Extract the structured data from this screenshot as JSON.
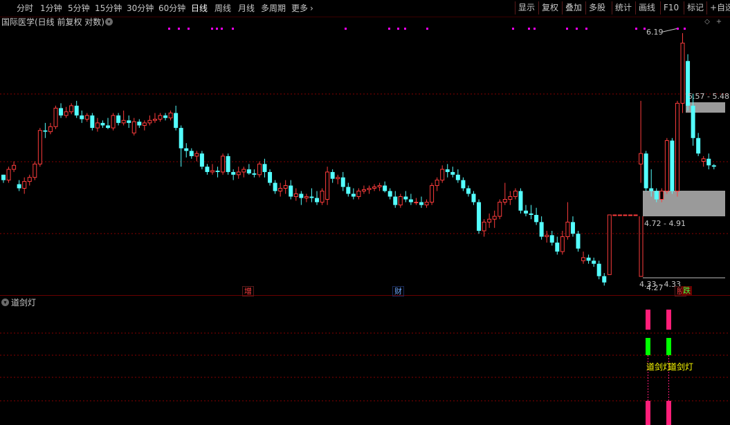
{
  "toolbar": {
    "periods": [
      "分时",
      "1分钟",
      "5分钟",
      "15分钟",
      "30分钟",
      "60分钟",
      "日线",
      "周线",
      "月线",
      "多周期",
      "更多"
    ],
    "active_period": "日线",
    "right_buttons": [
      "显示",
      "复权",
      "叠加",
      "多股",
      "统计",
      "画线",
      "F10",
      "标记",
      "+自选"
    ]
  },
  "chart": {
    "title": "国际医学(日线 前复权 对数)",
    "high_label": "6.19",
    "low_label": "4.27",
    "band_upper_label": "5.57 - 5.48",
    "band_lower_label": "4.72 - 4.91",
    "bottom_range_label": "4.33 - 4.33",
    "events": [
      {
        "text": "增",
        "color": "#ff4040"
      },
      {
        "text": "财",
        "color": "#6fa8ff"
      },
      {
        "text": "股",
        "color": "#ff4040"
      },
      {
        "text": "跌",
        "color": "#40ff40"
      }
    ]
  },
  "indicator": {
    "name": "道剑灯",
    "signal_label_1": "道剑灯",
    "signal_label_2": "道剑灯"
  },
  "colors": {
    "up": "#ff3c3c",
    "down": "#54ffff",
    "grid": "#8a0000",
    "marker": "#ff00ff",
    "signal_magenta": "#ff1e78",
    "signal_green": "#00ff00",
    "band": "#9a9a9a"
  },
  "candles": [
    [
      5.02,
      5.02,
      4.96,
      4.98
    ],
    [
      4.98,
      5.08,
      4.96,
      5.06
    ],
    [
      5.06,
      5.12,
      5.04,
      5.09
    ],
    [
      4.95,
      4.98,
      4.9,
      4.92
    ],
    [
      4.92,
      5.0,
      4.88,
      4.97
    ],
    [
      4.97,
      5.02,
      4.94,
      5.0
    ],
    [
      5.0,
      5.12,
      4.98,
      5.1
    ],
    [
      5.1,
      5.38,
      5.08,
      5.36
    ],
    [
      5.36,
      5.42,
      5.3,
      5.35
    ],
    [
      5.35,
      5.42,
      5.33,
      5.39
    ],
    [
      5.39,
      5.56,
      5.37,
      5.54
    ],
    [
      5.54,
      5.58,
      5.46,
      5.48
    ],
    [
      5.48,
      5.55,
      5.46,
      5.51
    ],
    [
      5.51,
      5.58,
      5.49,
      5.56
    ],
    [
      5.56,
      5.6,
      5.46,
      5.48
    ],
    [
      5.48,
      5.52,
      5.42,
      5.45
    ],
    [
      5.45,
      5.5,
      5.43,
      5.48
    ],
    [
      5.48,
      5.5,
      5.36,
      5.38
    ],
    [
      5.38,
      5.46,
      5.35,
      5.42
    ],
    [
      5.42,
      5.44,
      5.38,
      5.4
    ],
    [
      5.4,
      5.46,
      5.37,
      5.38
    ],
    [
      5.38,
      5.5,
      5.36,
      5.48
    ],
    [
      5.48,
      5.5,
      5.4,
      5.42
    ],
    [
      5.42,
      5.52,
      5.4,
      5.44
    ],
    [
      5.44,
      5.48,
      5.38,
      5.42
    ],
    [
      5.34,
      5.46,
      5.32,
      5.43
    ],
    [
      5.43,
      5.45,
      5.38,
      5.4
    ],
    [
      5.4,
      5.44,
      5.36,
      5.42
    ],
    [
      5.42,
      5.48,
      5.4,
      5.44
    ],
    [
      5.44,
      5.5,
      5.42,
      5.45
    ],
    [
      5.45,
      5.5,
      5.43,
      5.48
    ],
    [
      5.48,
      5.5,
      5.44,
      5.46
    ],
    [
      5.46,
      5.52,
      5.44,
      5.5
    ],
    [
      5.5,
      5.56,
      5.36,
      5.38
    ],
    [
      5.38,
      5.4,
      5.08,
      5.22
    ],
    [
      5.22,
      5.26,
      5.15,
      5.2
    ],
    [
      5.2,
      5.22,
      5.14,
      5.16
    ],
    [
      5.16,
      5.2,
      5.12,
      5.18
    ],
    [
      5.18,
      5.2,
      5.06,
      5.08
    ],
    [
      5.08,
      5.1,
      5.02,
      5.04
    ],
    [
      5.04,
      5.1,
      5.02,
      5.05
    ],
    [
      5.05,
      5.08,
      5.0,
      5.04
    ],
    [
      5.04,
      5.18,
      5.02,
      5.16
    ],
    [
      5.16,
      5.18,
      5.02,
      5.04
    ],
    [
      5.04,
      5.06,
      4.98,
      5.02
    ],
    [
      5.02,
      5.08,
      4.99,
      5.04
    ],
    [
      5.04,
      5.08,
      5.0,
      5.06
    ],
    [
      5.06,
      5.1,
      5.02,
      5.03
    ],
    [
      5.03,
      5.06,
      5.0,
      5.02
    ],
    [
      5.02,
      5.12,
      5.0,
      5.1
    ],
    [
      5.1,
      5.14,
      5.0,
      5.04
    ],
    [
      5.04,
      5.06,
      4.94,
      4.96
    ],
    [
      4.96,
      4.98,
      4.88,
      4.9
    ],
    [
      4.9,
      4.96,
      4.86,
      4.92
    ],
    [
      4.92,
      4.98,
      4.88,
      4.94
    ],
    [
      4.94,
      4.98,
      4.84,
      4.86
    ],
    [
      4.86,
      4.92,
      4.83,
      4.88
    ],
    [
      4.88,
      4.9,
      4.8,
      4.85
    ],
    [
      4.85,
      4.88,
      4.82,
      4.86
    ],
    [
      4.86,
      4.92,
      4.82,
      4.85
    ],
    [
      4.85,
      4.9,
      4.8,
      4.82
    ],
    [
      4.82,
      4.92,
      4.8,
      4.9
    ],
    [
      4.84,
      5.08,
      4.8,
      5.04
    ],
    [
      5.04,
      5.06,
      4.96,
      4.99
    ],
    [
      4.99,
      5.02,
      4.95,
      5.0
    ],
    [
      5.0,
      5.04,
      4.9,
      4.93
    ],
    [
      4.93,
      4.96,
      4.86,
      4.88
    ],
    [
      4.88,
      4.92,
      4.84,
      4.86
    ],
    [
      4.86,
      4.92,
      4.84,
      4.9
    ],
    [
      4.9,
      4.94,
      4.88,
      4.91
    ],
    [
      4.91,
      4.94,
      4.88,
      4.92
    ],
    [
      4.92,
      4.95,
      4.9,
      4.93
    ],
    [
      4.93,
      4.96,
      4.9,
      4.94
    ],
    [
      4.94,
      4.97,
      4.89,
      4.9
    ],
    [
      4.9,
      4.92,
      4.84,
      4.86
    ],
    [
      4.86,
      4.9,
      4.78,
      4.8
    ],
    [
      4.8,
      4.88,
      4.78,
      4.86
    ],
    [
      4.86,
      4.9,
      4.82,
      4.84
    ],
    [
      4.84,
      4.88,
      4.8,
      4.82
    ],
    [
      4.82,
      4.85,
      4.8,
      4.82
    ],
    [
      4.82,
      4.86,
      4.78,
      4.8
    ],
    [
      4.8,
      4.84,
      4.78,
      4.82
    ],
    [
      4.82,
      4.96,
      4.8,
      4.94
    ],
    [
      4.94,
      5.0,
      4.9,
      4.98
    ],
    [
      4.98,
      5.09,
      4.96,
      5.06
    ],
    [
      5.06,
      5.1,
      5.0,
      5.04
    ],
    [
      5.04,
      5.08,
      5.0,
      5.02
    ],
    [
      5.02,
      5.06,
      4.96,
      4.98
    ],
    [
      4.98,
      5.0,
      4.9,
      4.92
    ],
    [
      4.92,
      4.94,
      4.86,
      4.88
    ],
    [
      4.88,
      4.9,
      4.8,
      4.82
    ],
    [
      4.82,
      4.84,
      4.6,
      4.62
    ],
    [
      4.62,
      4.7,
      4.58,
      4.68
    ],
    [
      4.68,
      4.74,
      4.64,
      4.7
    ],
    [
      4.7,
      4.76,
      4.64,
      4.72
    ],
    [
      4.72,
      4.84,
      4.7,
      4.82
    ],
    [
      4.82,
      4.96,
      4.8,
      4.84
    ],
    [
      4.84,
      4.9,
      4.8,
      4.86
    ],
    [
      4.86,
      4.92,
      4.84,
      4.9
    ],
    [
      4.9,
      4.92,
      4.74,
      4.76
    ],
    [
      4.76,
      4.8,
      4.72,
      4.74
    ],
    [
      4.74,
      4.8,
      4.7,
      4.73
    ],
    [
      4.73,
      4.78,
      4.66,
      4.68
    ],
    [
      4.68,
      4.72,
      4.56,
      4.58
    ],
    [
      4.58,
      4.62,
      4.54,
      4.59
    ],
    [
      4.59,
      4.62,
      4.52,
      4.54
    ],
    [
      4.54,
      4.58,
      4.46,
      4.48
    ],
    [
      4.48,
      4.62,
      4.46,
      4.58
    ],
    [
      4.58,
      4.82,
      4.56,
      4.68
    ],
    [
      4.68,
      4.72,
      4.58,
      4.6
    ],
    [
      4.6,
      4.62,
      4.48,
      4.5
    ],
    [
      4.42,
      4.48,
      4.4,
      4.44
    ],
    [
      4.44,
      4.46,
      4.4,
      4.42
    ],
    [
      4.42,
      4.44,
      4.38,
      4.4
    ],
    [
      4.4,
      4.42,
      4.3,
      4.32
    ],
    [
      4.32,
      4.34,
      4.26,
      4.28
    ],
    [
      4.33,
      4.73,
      4.33,
      4.73
    ],
    [
      4.73,
      4.73,
      4.73,
      4.73
    ],
    [
      4.73,
      4.73,
      4.73,
      4.73
    ],
    [
      4.73,
      4.73,
      4.73,
      4.73
    ],
    [
      4.73,
      4.73,
      4.73,
      4.73
    ],
    [
      4.73,
      4.73,
      4.73,
      4.73
    ],
    [
      5.1,
      5.6,
      4.96,
      5.18
    ],
    [
      5.18,
      5.2,
      4.9,
      4.92
    ],
    [
      4.92,
      5.06,
      4.86,
      4.9
    ],
    [
      4.9,
      4.92,
      4.82,
      4.84
    ],
    [
      4.84,
      4.92,
      4.82,
      4.9
    ],
    [
      4.9,
      5.3,
      4.88,
      5.28
    ],
    [
      5.28,
      5.3,
      4.88,
      4.9
    ],
    [
      4.9,
      5.6,
      4.86,
      5.58
    ],
    [
      5.58,
      6.19,
      5.5,
      6.1
    ],
    [
      5.94,
      6.0,
      5.52,
      5.56
    ],
    [
      5.56,
      5.66,
      5.24,
      5.3
    ],
    [
      5.3,
      5.34,
      5.16,
      5.18
    ],
    [
      5.12,
      5.16,
      5.08,
      5.14
    ],
    [
      5.14,
      5.18,
      5.06,
      5.09
    ],
    [
      5.09,
      5.1,
      5.06,
      5.08
    ]
  ]
}
